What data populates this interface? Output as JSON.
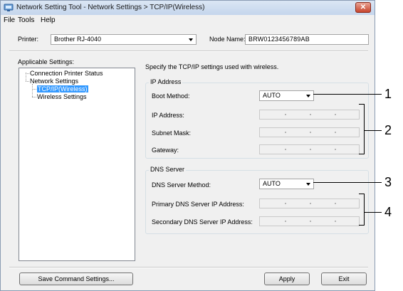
{
  "window": {
    "title": "Network Setting Tool - Network Settings > TCP/IP(Wireless)",
    "close_label": "✕"
  },
  "menu": [
    "File",
    "Tools",
    "Help"
  ],
  "printer": {
    "label": "Printer:",
    "value": "Brother RJ-4040"
  },
  "node": {
    "label": "Node Name:",
    "value": "BRW0123456789AB"
  },
  "applicable_settings": {
    "label": "Applicable Settings:",
    "tree": [
      "Connection Printer Status",
      "Network Settings",
      "TCP/IP(Wireless)",
      "Wireless Settings"
    ]
  },
  "description": "Specify the TCP/IP settings used with wireless.",
  "ip_address_group": {
    "title": "IP Address",
    "boot_method_label": "Boot Method:",
    "boot_method_value": "AUTO",
    "ip_address_label": "IP Address:",
    "subnet_mask_label": "Subnet Mask:",
    "gateway_label": "Gateway:"
  },
  "dns_group": {
    "title": "DNS Server",
    "method_label": "DNS Server Method:",
    "method_value": "AUTO",
    "primary_label": "Primary DNS Server IP Address:",
    "secondary_label": "Secondary DNS Server IP Address:"
  },
  "buttons": {
    "save": "Save Command Settings...",
    "apply": "Apply",
    "exit": "Exit"
  },
  "callouts": [
    "1",
    "2",
    "3",
    "4"
  ]
}
